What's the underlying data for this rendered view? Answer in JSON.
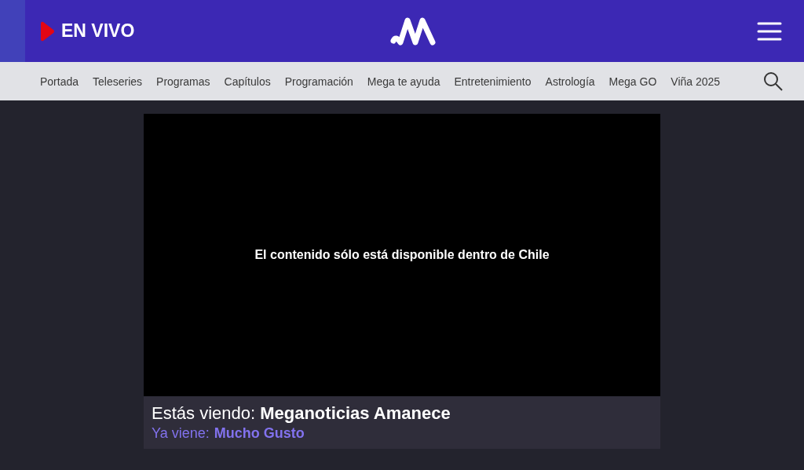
{
  "header": {
    "live_label": "EN VIVO"
  },
  "nav": {
    "items": [
      {
        "label": "Portada"
      },
      {
        "label": "Teleseries"
      },
      {
        "label": "Programas"
      },
      {
        "label": "Capítulos"
      },
      {
        "label": "Programación"
      },
      {
        "label": "Mega te ayuda"
      },
      {
        "label": "Entretenimiento"
      },
      {
        "label": "Astrología"
      },
      {
        "label": "Mega GO"
      },
      {
        "label": "Viña 2025"
      }
    ]
  },
  "player": {
    "message": "El contenido sólo está disponible dentro de Chile"
  },
  "now_playing": {
    "current": "Estás viendo: **Meganoticias Amanece**",
    "next_label": "Ya viene:",
    "next_title": "Mucho Gusto"
  }
}
